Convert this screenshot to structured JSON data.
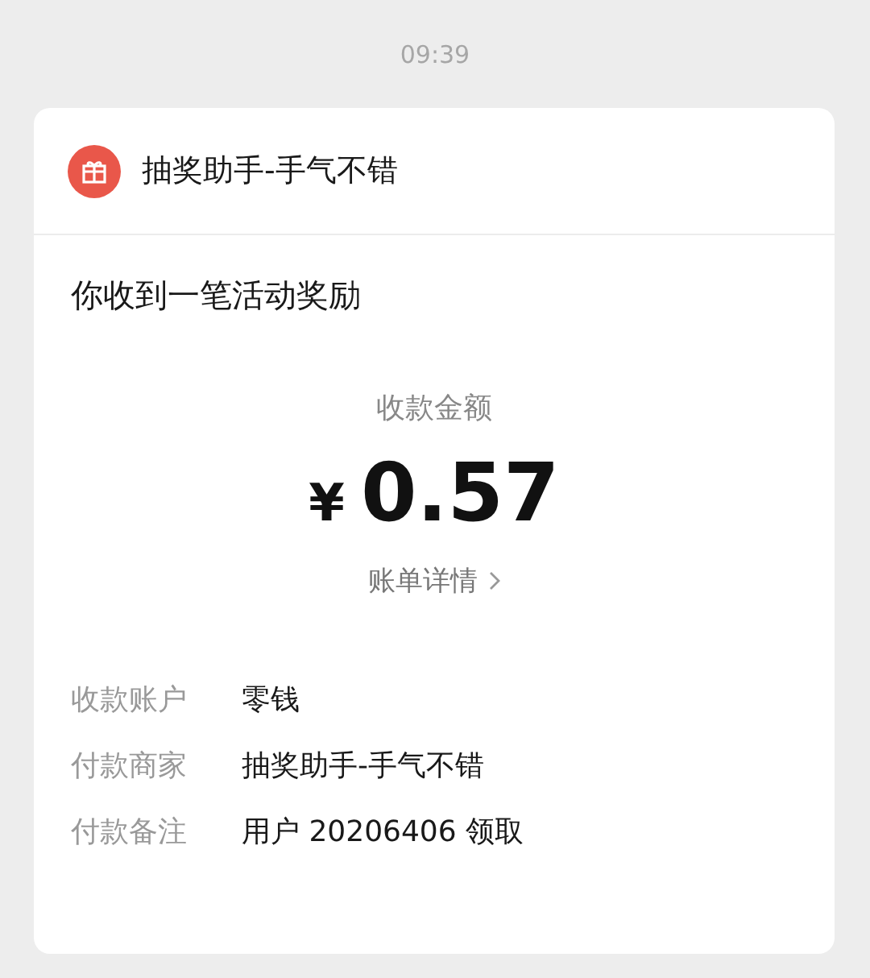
{
  "time": "09:39",
  "card": {
    "sender": "抽奖助手-手气不错",
    "message": "你收到一笔活动奖励",
    "amount_label": "收款金额",
    "currency": "¥",
    "amount": "0.57",
    "details_link": "账单详情",
    "rows": [
      {
        "label": "收款账户",
        "value": "零钱"
      },
      {
        "label": "付款商家",
        "value": "抽奖助手-手气不错"
      },
      {
        "label": "付款备注",
        "value": "用户 20206406 领取"
      }
    ]
  }
}
